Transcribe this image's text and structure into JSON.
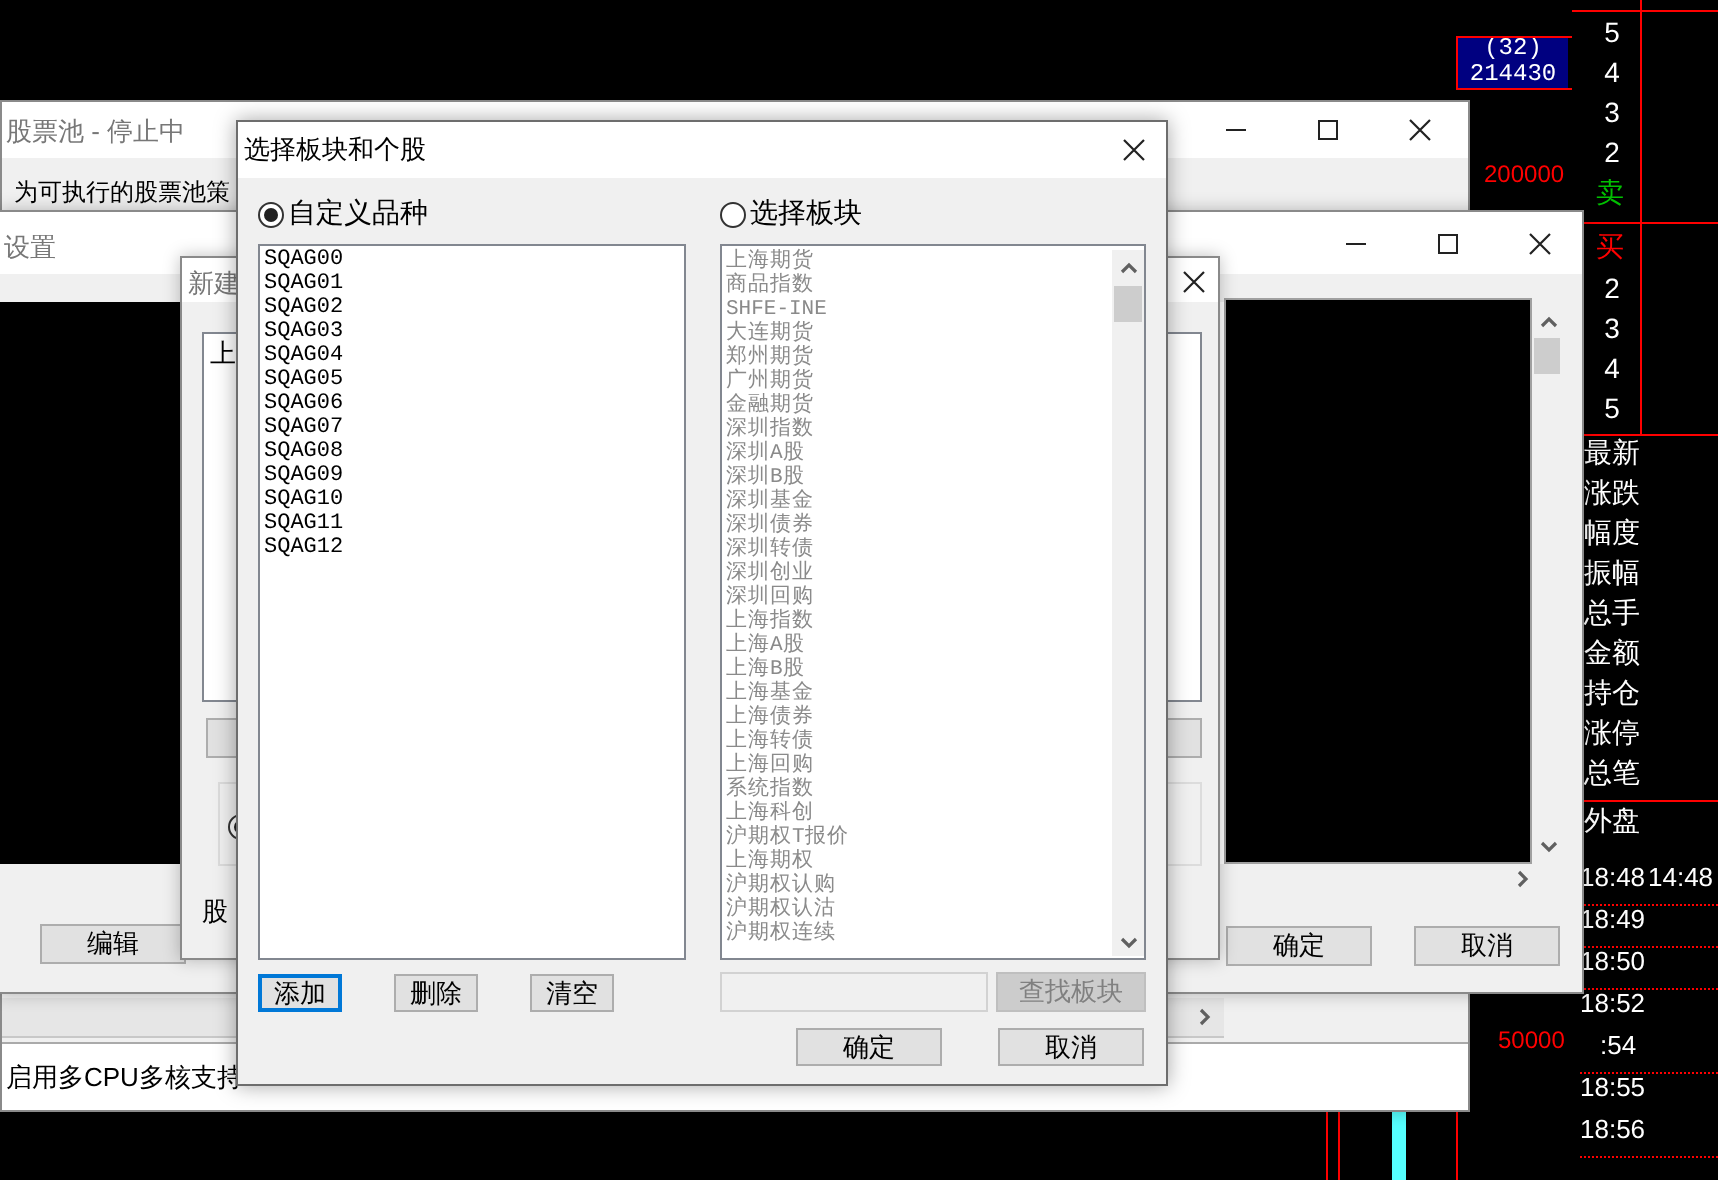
{
  "background_app": {
    "quote_box": {
      "count": "(32)",
      "volume": "214430"
    },
    "volume_mark": "200000",
    "ask_levels": [
      "5",
      "4",
      "3",
      "2"
    ],
    "sell_label": "卖",
    "buy_label": "买",
    "bid_levels": [
      "2",
      "3",
      "4",
      "5"
    ],
    "fields": [
      "最新",
      "涨跌",
      "幅度",
      "振幅",
      "总手",
      "金额",
      "持仓",
      "涨停",
      "总笔"
    ],
    "outer_label": "外盘",
    "ticks": [
      {
        "time": "18:48",
        "extra": "14:48"
      },
      {
        "time": "18:49"
      },
      {
        "time": "18:50"
      },
      {
        "time": "18:52"
      },
      {
        "time": ":54"
      },
      {
        "time": "18:55"
      },
      {
        "time": "18:56"
      }
    ],
    "volume_mark_2": "50000"
  },
  "pool_window": {
    "title": "股票池 - 停止中",
    "description": "为可执行的股票池策",
    "footer": "启用多CPU多核支持"
  },
  "settings_window": {
    "title": "设置",
    "buttons": [
      "编辑",
      "确定",
      "取消"
    ]
  },
  "new_window": {
    "title": "新建",
    "list_text": "上",
    "group_radio": {
      "selected": true
    },
    "footer_label": "股"
  },
  "dialog": {
    "title": "选择板块和个股",
    "options": [
      {
        "label": "自定义品种",
        "selected": true
      },
      {
        "label": "选择板块",
        "selected": false
      }
    ],
    "custom_list": [
      "SQAG00",
      "SQAG01",
      "SQAG02",
      "SQAG03",
      "SQAG04",
      "SQAG05",
      "SQAG06",
      "SQAG07",
      "SQAG08",
      "SQAG09",
      "SQAG10",
      "SQAG11",
      "SQAG12"
    ],
    "block_list": {
      "disabled": true,
      "items": [
        "上海期货",
        "商品指数",
        "SHFE-INE",
        "大连期货",
        "郑州期货",
        "广州期货",
        "金融期货",
        "深圳指数",
        "深圳A股",
        "深圳B股",
        "深圳基金",
        "深圳债券",
        "深圳转债",
        "深圳创业",
        "深圳回购",
        "上海指数",
        "上海A股",
        "上海B股",
        "上海基金",
        "上海债券",
        "上海转债",
        "上海回购",
        "系统指数",
        "上海科创",
        "沪期权T报价",
        "上海期权",
        "沪期权认购",
        "沪期权认沽",
        "沪期权连续"
      ]
    },
    "list_buttons": [
      {
        "label": "添加",
        "focused": true
      },
      {
        "label": "删除",
        "focused": false
      },
      {
        "label": "清空",
        "focused": false
      }
    ],
    "search": {
      "disabled": true,
      "button": "查找板块"
    },
    "buttons": [
      "确定",
      "取消"
    ]
  }
}
